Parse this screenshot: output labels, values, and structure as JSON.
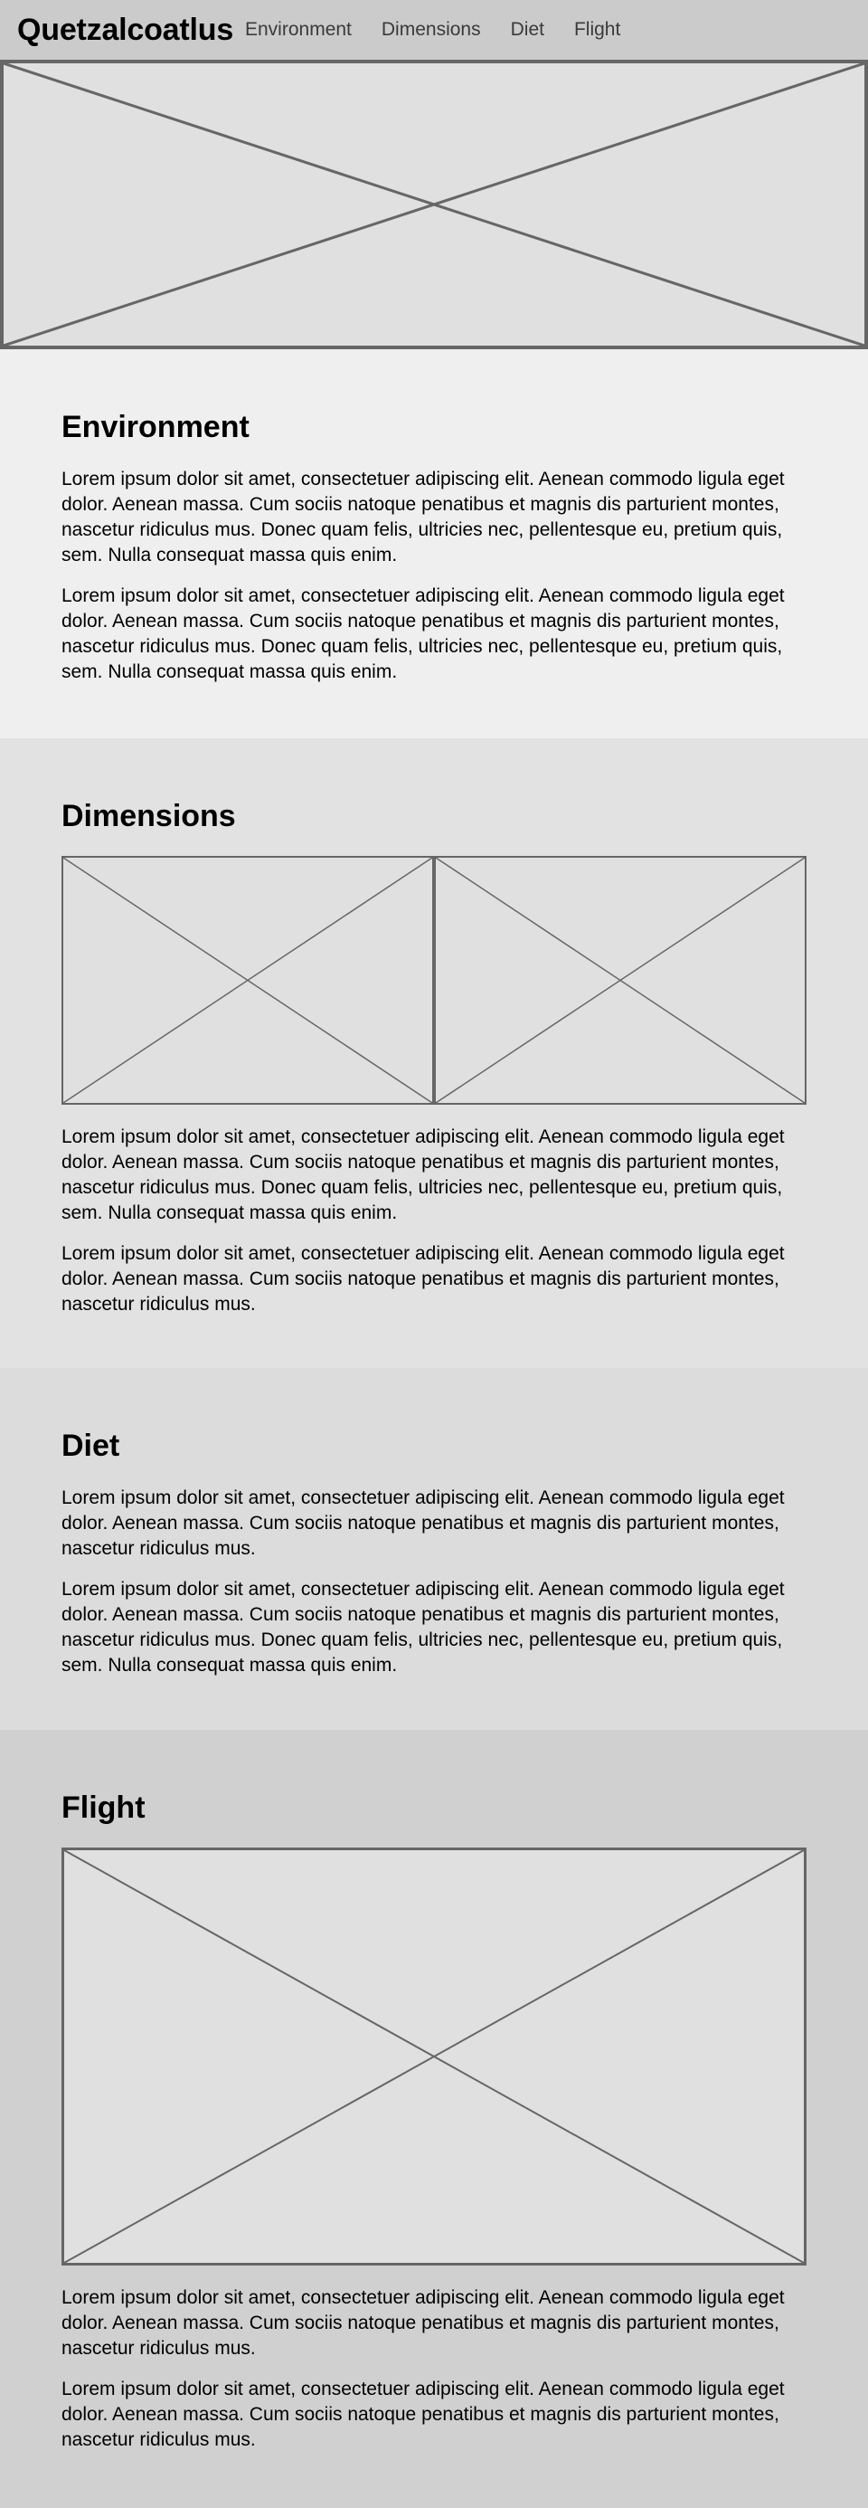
{
  "header": {
    "title": "Quetzalcoatlus",
    "nav": [
      "Environment",
      "Dimensions",
      "Diet",
      "Flight"
    ]
  },
  "sections": {
    "environment": {
      "heading": "Environment",
      "paragraphs": [
        "Lorem ipsum dolor sit amet, consectetuer adipiscing elit. Aenean commodo ligula eget dolor. Aenean massa. Cum sociis natoque penatibus et magnis dis parturient montes, nascetur ridiculus mus. Donec quam felis, ultricies nec, pellentesque eu, pretium quis, sem. Nulla consequat massa quis enim.",
        "Lorem ipsum dolor sit amet, consectetuer adipiscing elit. Aenean commodo ligula eget dolor. Aenean massa. Cum sociis natoque penatibus et magnis dis parturient montes, nascetur ridiculus mus. Donec quam felis, ultricies nec, pellentesque eu, pretium quis, sem. Nulla consequat massa quis enim."
      ]
    },
    "dimensions": {
      "heading": "Dimensions",
      "paragraphs": [
        "Lorem ipsum dolor sit amet, consectetuer adipiscing elit. Aenean commodo ligula eget dolor. Aenean massa. Cum sociis natoque penatibus et magnis dis parturient montes, nascetur ridiculus mus. Donec quam felis, ultricies nec, pellentesque eu, pretium quis, sem. Nulla consequat massa quis enim.",
        "Lorem ipsum dolor sit amet, consectetuer adipiscing elit. Aenean commodo ligula eget dolor. Aenean massa. Cum sociis natoque penatibus et magnis dis parturient montes, nascetur ridiculus mus."
      ]
    },
    "diet": {
      "heading": "Diet",
      "paragraphs": [
        "Lorem ipsum dolor sit amet, consectetuer adipiscing elit. Aenean commodo ligula eget dolor. Aenean massa. Cum sociis natoque penatibus et magnis dis parturient montes, nascetur ridiculus mus.",
        "Lorem ipsum dolor sit amet, consectetuer adipiscing elit. Aenean commodo ligula eget dolor. Aenean massa. Cum sociis natoque penatibus et magnis dis parturient montes, nascetur ridiculus mus. Donec quam felis, ultricies nec, pellentesque eu, pretium quis, sem. Nulla consequat massa quis enim."
      ]
    },
    "flight": {
      "heading": "Flight",
      "paragraphs": [
        "Lorem ipsum dolor sit amet, consectetuer adipiscing elit. Aenean commodo ligula eget dolor. Aenean massa. Cum sociis natoque penatibus et magnis dis parturient montes, nascetur ridiculus mus.",
        "Lorem ipsum dolor sit amet, consectetuer adipiscing elit. Aenean commodo ligula eget dolor. Aenean massa. Cum sociis natoque penatibus et magnis dis parturient montes, nascetur ridiculus mus."
      ]
    }
  },
  "colors": {
    "header_bg": "#cbcbcb",
    "environment_bg": "#efefef",
    "dimensions_bg": "#e2e2e2",
    "diet_bg": "#dcdcdc",
    "flight_bg": "#d0d0d0",
    "placeholder_fill": "#e0e0e0",
    "placeholder_stroke": "#666666"
  }
}
